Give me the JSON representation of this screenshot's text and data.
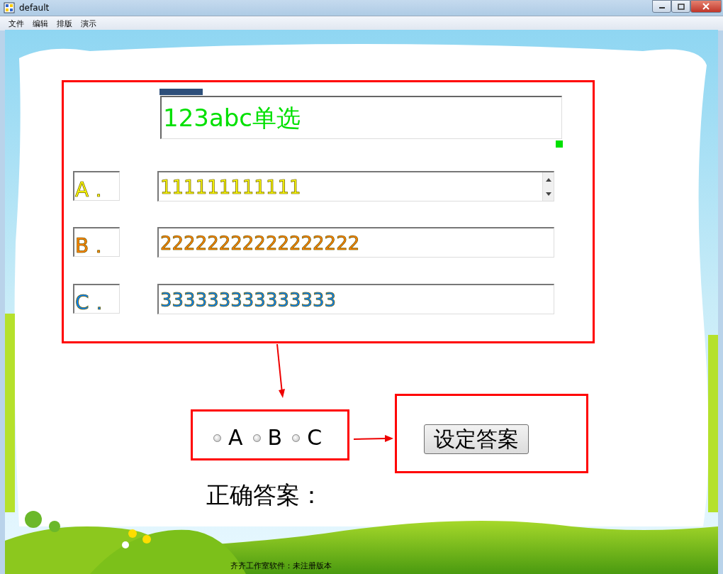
{
  "window": {
    "title": "default"
  },
  "menu": [
    "文件",
    "编辑",
    "排版",
    "演示"
  ],
  "question": {
    "text": "123abc单选"
  },
  "options": [
    {
      "label": "A．",
      "value": "111111111111",
      "color": "#ffff00",
      "scroll_arrows": true
    },
    {
      "label": "B．",
      "value": "22222222222222222",
      "color": "#ff7f00",
      "scroll_arrows": false
    },
    {
      "label": "C．",
      "value": "333333333333333",
      "color": "#0080ff",
      "scroll_arrows": false
    }
  ],
  "answer_choices": [
    {
      "label": "A",
      "selected": false
    },
    {
      "label": "B",
      "selected": false
    },
    {
      "label": "C",
      "selected": false
    }
  ],
  "set_answer_button": "设定答案",
  "correct_answer_label": "正确答案：",
  "status_bar": "齐齐工作室软件：未注册版本"
}
